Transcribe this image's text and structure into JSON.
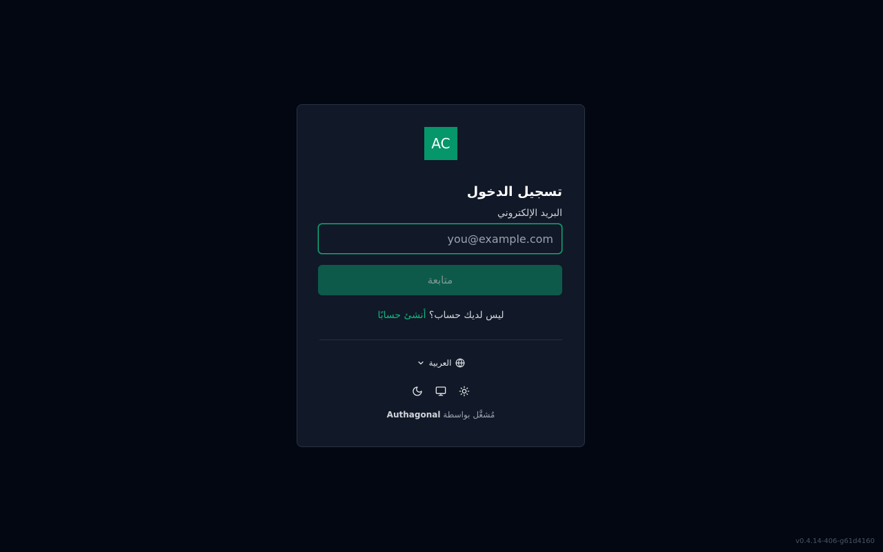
{
  "brand": {
    "logo_text": "AC",
    "logo_color": "#059669"
  },
  "login": {
    "title": "تسجيل الدخول",
    "email_label": "البريد الإلكتروني",
    "email_value": "",
    "email_placeholder": "you@example.com",
    "continue_label": "متابعة",
    "no_account_text": "ليس لديك حساب؟",
    "create_account_link": "أنشئ حسابًا"
  },
  "language": {
    "icon": "globe-icon",
    "selected": "العربية",
    "chevron_icon": "chevron-down-icon"
  },
  "theme": {
    "options": [
      {
        "name": "light",
        "icon": "sun-icon"
      },
      {
        "name": "system",
        "icon": "monitor-icon"
      },
      {
        "name": "dark",
        "icon": "moon-icon"
      }
    ]
  },
  "footer": {
    "powered_prefix": "مُشغَّل بواسطة",
    "powered_brand": "Authagonal",
    "version": "v0.4.14-406-g61d4160"
  },
  "colors": {
    "background": "#030712",
    "card": "#111827",
    "accent": "#10b981",
    "button": "#0d5a4b"
  }
}
